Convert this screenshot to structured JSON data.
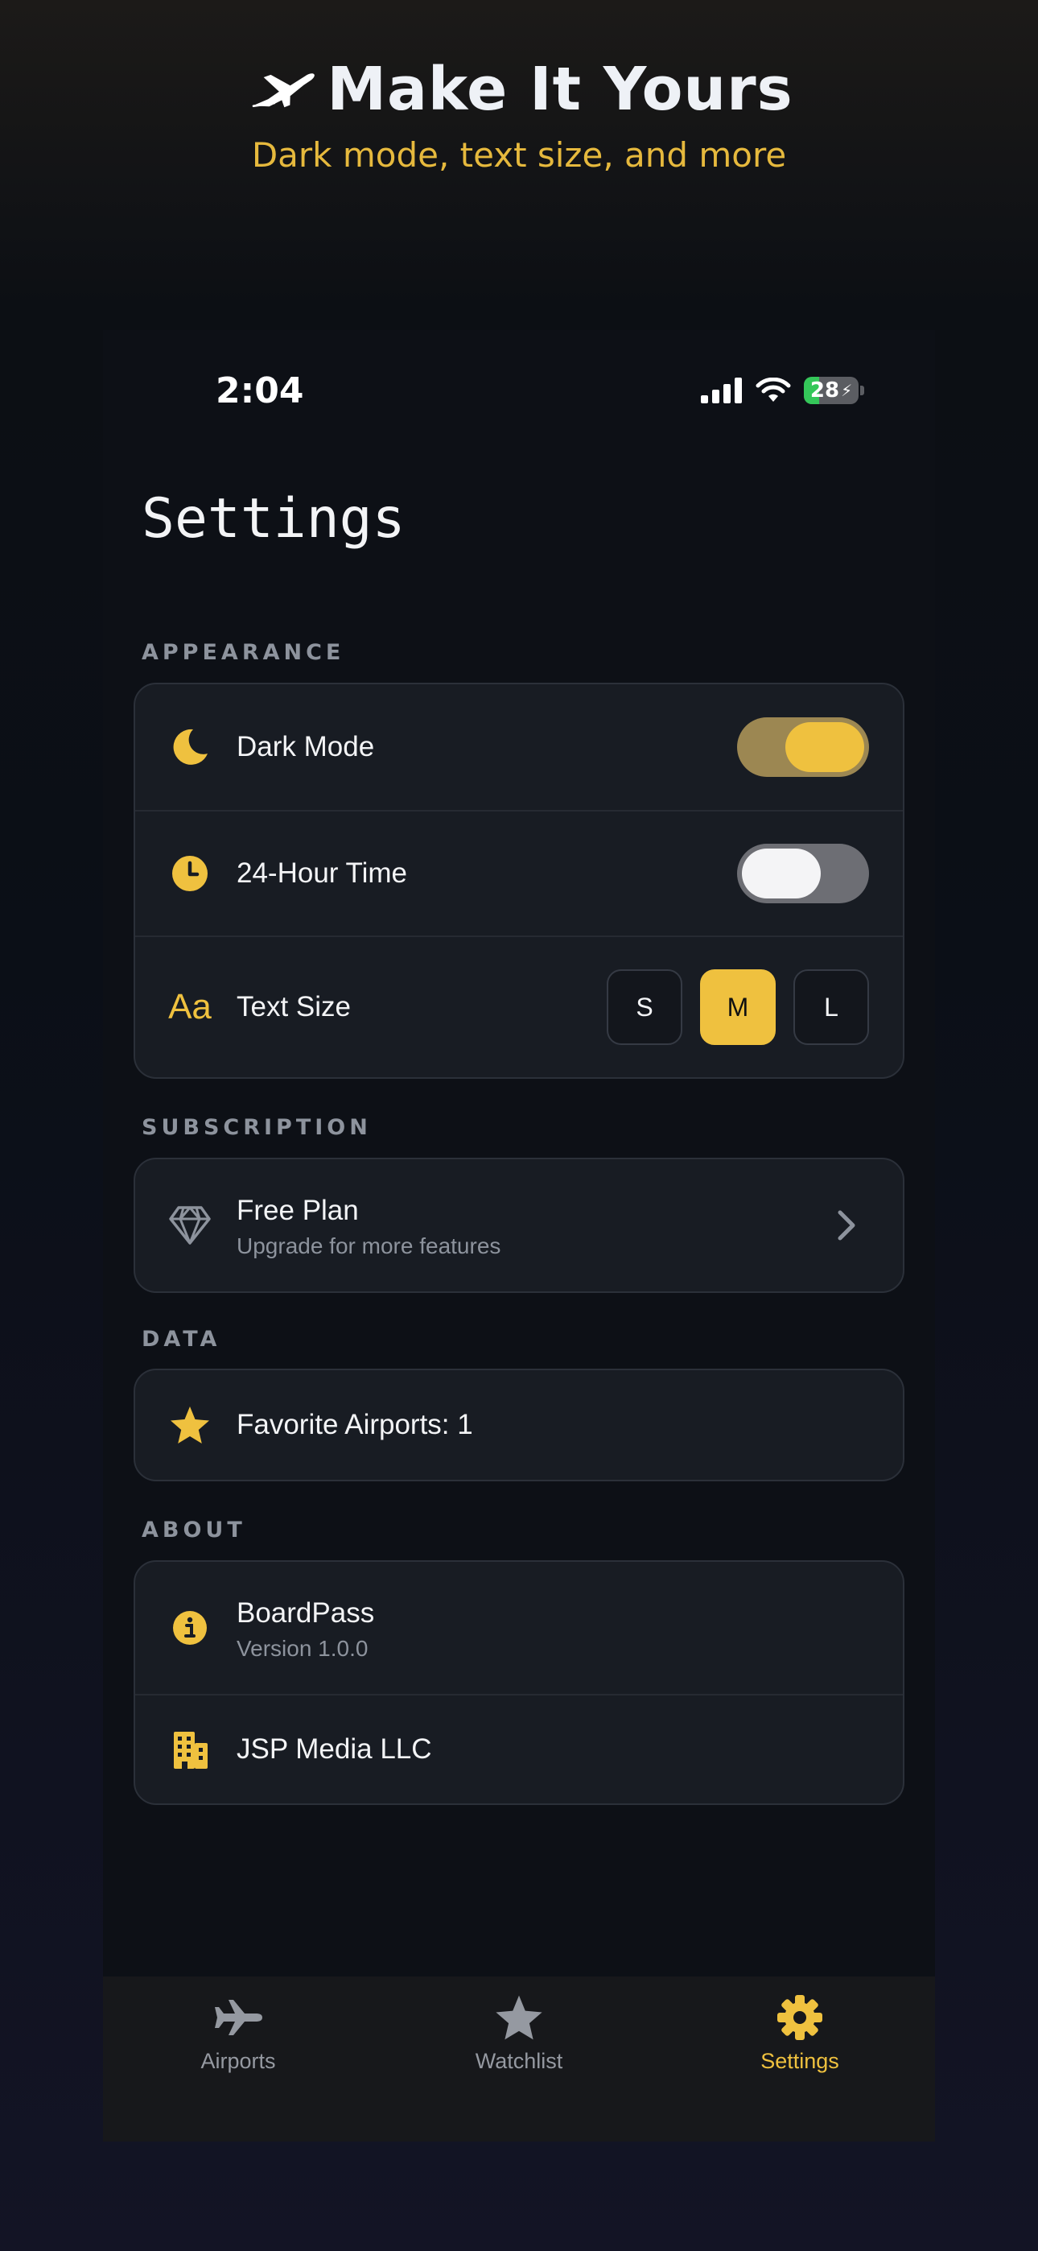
{
  "promo": {
    "title": "Make It Yours",
    "subtitle": "Dark mode, text size, and more",
    "icon": "airplane-icon"
  },
  "status_bar": {
    "time": "2:04",
    "battery": "28",
    "battery_level_percent": 28,
    "icons": [
      "signal-icon",
      "wifi-icon",
      "battery-charging-icon"
    ]
  },
  "page": {
    "title": "Settings"
  },
  "sections": {
    "appearance": {
      "label": "APPEARANCE",
      "dark_mode": {
        "label": "Dark Mode",
        "icon": "moon-icon",
        "enabled": true
      },
      "hour24": {
        "label": "24-Hour Time",
        "icon": "clock-icon",
        "enabled": false
      },
      "text_size": {
        "label": "Text Size",
        "icon": "text-size-icon",
        "icon_text": "Aa",
        "options": [
          "S",
          "M",
          "L"
        ],
        "selected": "M"
      }
    },
    "subscription": {
      "label": "SUBSCRIPTION",
      "plan": {
        "label": "Free Plan",
        "sub": "Upgrade for more features",
        "icon": "diamond-icon"
      }
    },
    "data": {
      "label": "DATA",
      "favorites": {
        "label": "Favorite Airports: 1",
        "icon": "star-icon"
      }
    },
    "about": {
      "label": "ABOUT",
      "app": {
        "label": "BoardPass",
        "sub": "Version 1.0.0",
        "icon": "info-icon"
      },
      "company": {
        "label": "JSP Media LLC",
        "icon": "building-icon"
      }
    }
  },
  "tabbar": {
    "items": [
      {
        "label": "Airports",
        "icon": "airplane-icon",
        "active": false
      },
      {
        "label": "Watchlist",
        "icon": "star-icon",
        "active": false
      },
      {
        "label": "Settings",
        "icon": "gear-icon",
        "active": true
      }
    ]
  },
  "colors": {
    "accent": "#efc13f",
    "promo_subtitle": "#e6b93d",
    "card_bg": "#181c23",
    "screen_bg": "#0d1016",
    "muted_text": "#8d939d"
  }
}
